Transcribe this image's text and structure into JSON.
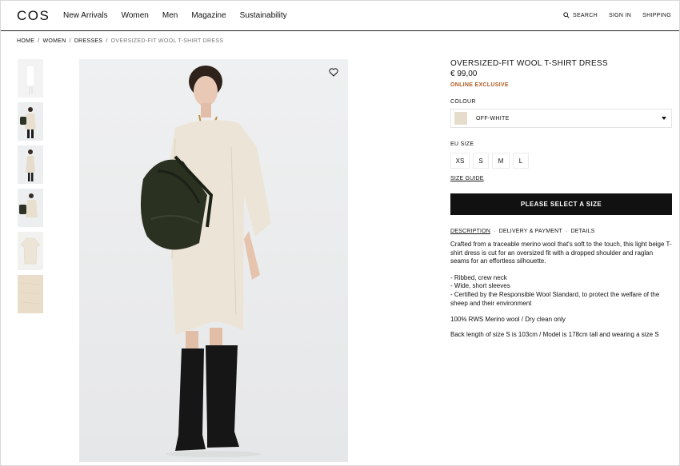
{
  "header": {
    "logo": "COS",
    "nav": [
      "New Arrivals",
      "Women",
      "Men",
      "Magazine",
      "Sustainability"
    ],
    "search_label": "SEARCH",
    "sign_in_label": "SIGN IN",
    "shipping_label": "SHIPPING"
  },
  "breadcrumb": {
    "home": "HOME",
    "women": "WOMEN",
    "dresses": "DRESSES",
    "current": "OVERSIZED-FIT WOOL T-SHIRT DRESS",
    "separator": "/"
  },
  "product": {
    "title": "OVERSIZED-FIT WOOL T-SHIRT DRESS",
    "price": "€ 99,00",
    "badge": "ONLINE EXCLUSIVE",
    "colour_label": "COLOUR",
    "colour_value": "OFF-WHITE",
    "swatch_color": "#e6dccb",
    "size_label": "EU SIZE",
    "sizes": [
      "XS",
      "S",
      "M",
      "L"
    ],
    "size_guide": "SIZE GUIDE",
    "cta": "PLEASE SELECT A SIZE"
  },
  "tabs": {
    "description": "DESCRIPTION",
    "delivery": "DELIVERY & PAYMENT",
    "details": "DETAILS",
    "separator": "·"
  },
  "description": {
    "text": "Crafted from a traceable merino wool that's soft to the touch, this light beige T-shirt dress is cut for an oversized fit with a dropped shoulder and raglan seams for an effortless silhouette.",
    "bullets": [
      "- Ribbed, crew neck",
      "- Wide, short sleeves",
      "- Certified by the Responsible Wool Standard, to protect the welfare of the sheep and their environment"
    ],
    "material": "100% RWS Merino wool / Dry clean only",
    "measurements": "Back length of size S is 103cm / Model is 178cm tall and wearing a size S"
  },
  "colors": {
    "accent_badge": "#b05a23",
    "cta_bg": "#111111",
    "image_bg": "#edeeef",
    "dress": "#ece4d6"
  },
  "icons": {
    "search": "search-icon",
    "wishlist": "heart-icon",
    "dropdown": "caret-down-icon"
  }
}
